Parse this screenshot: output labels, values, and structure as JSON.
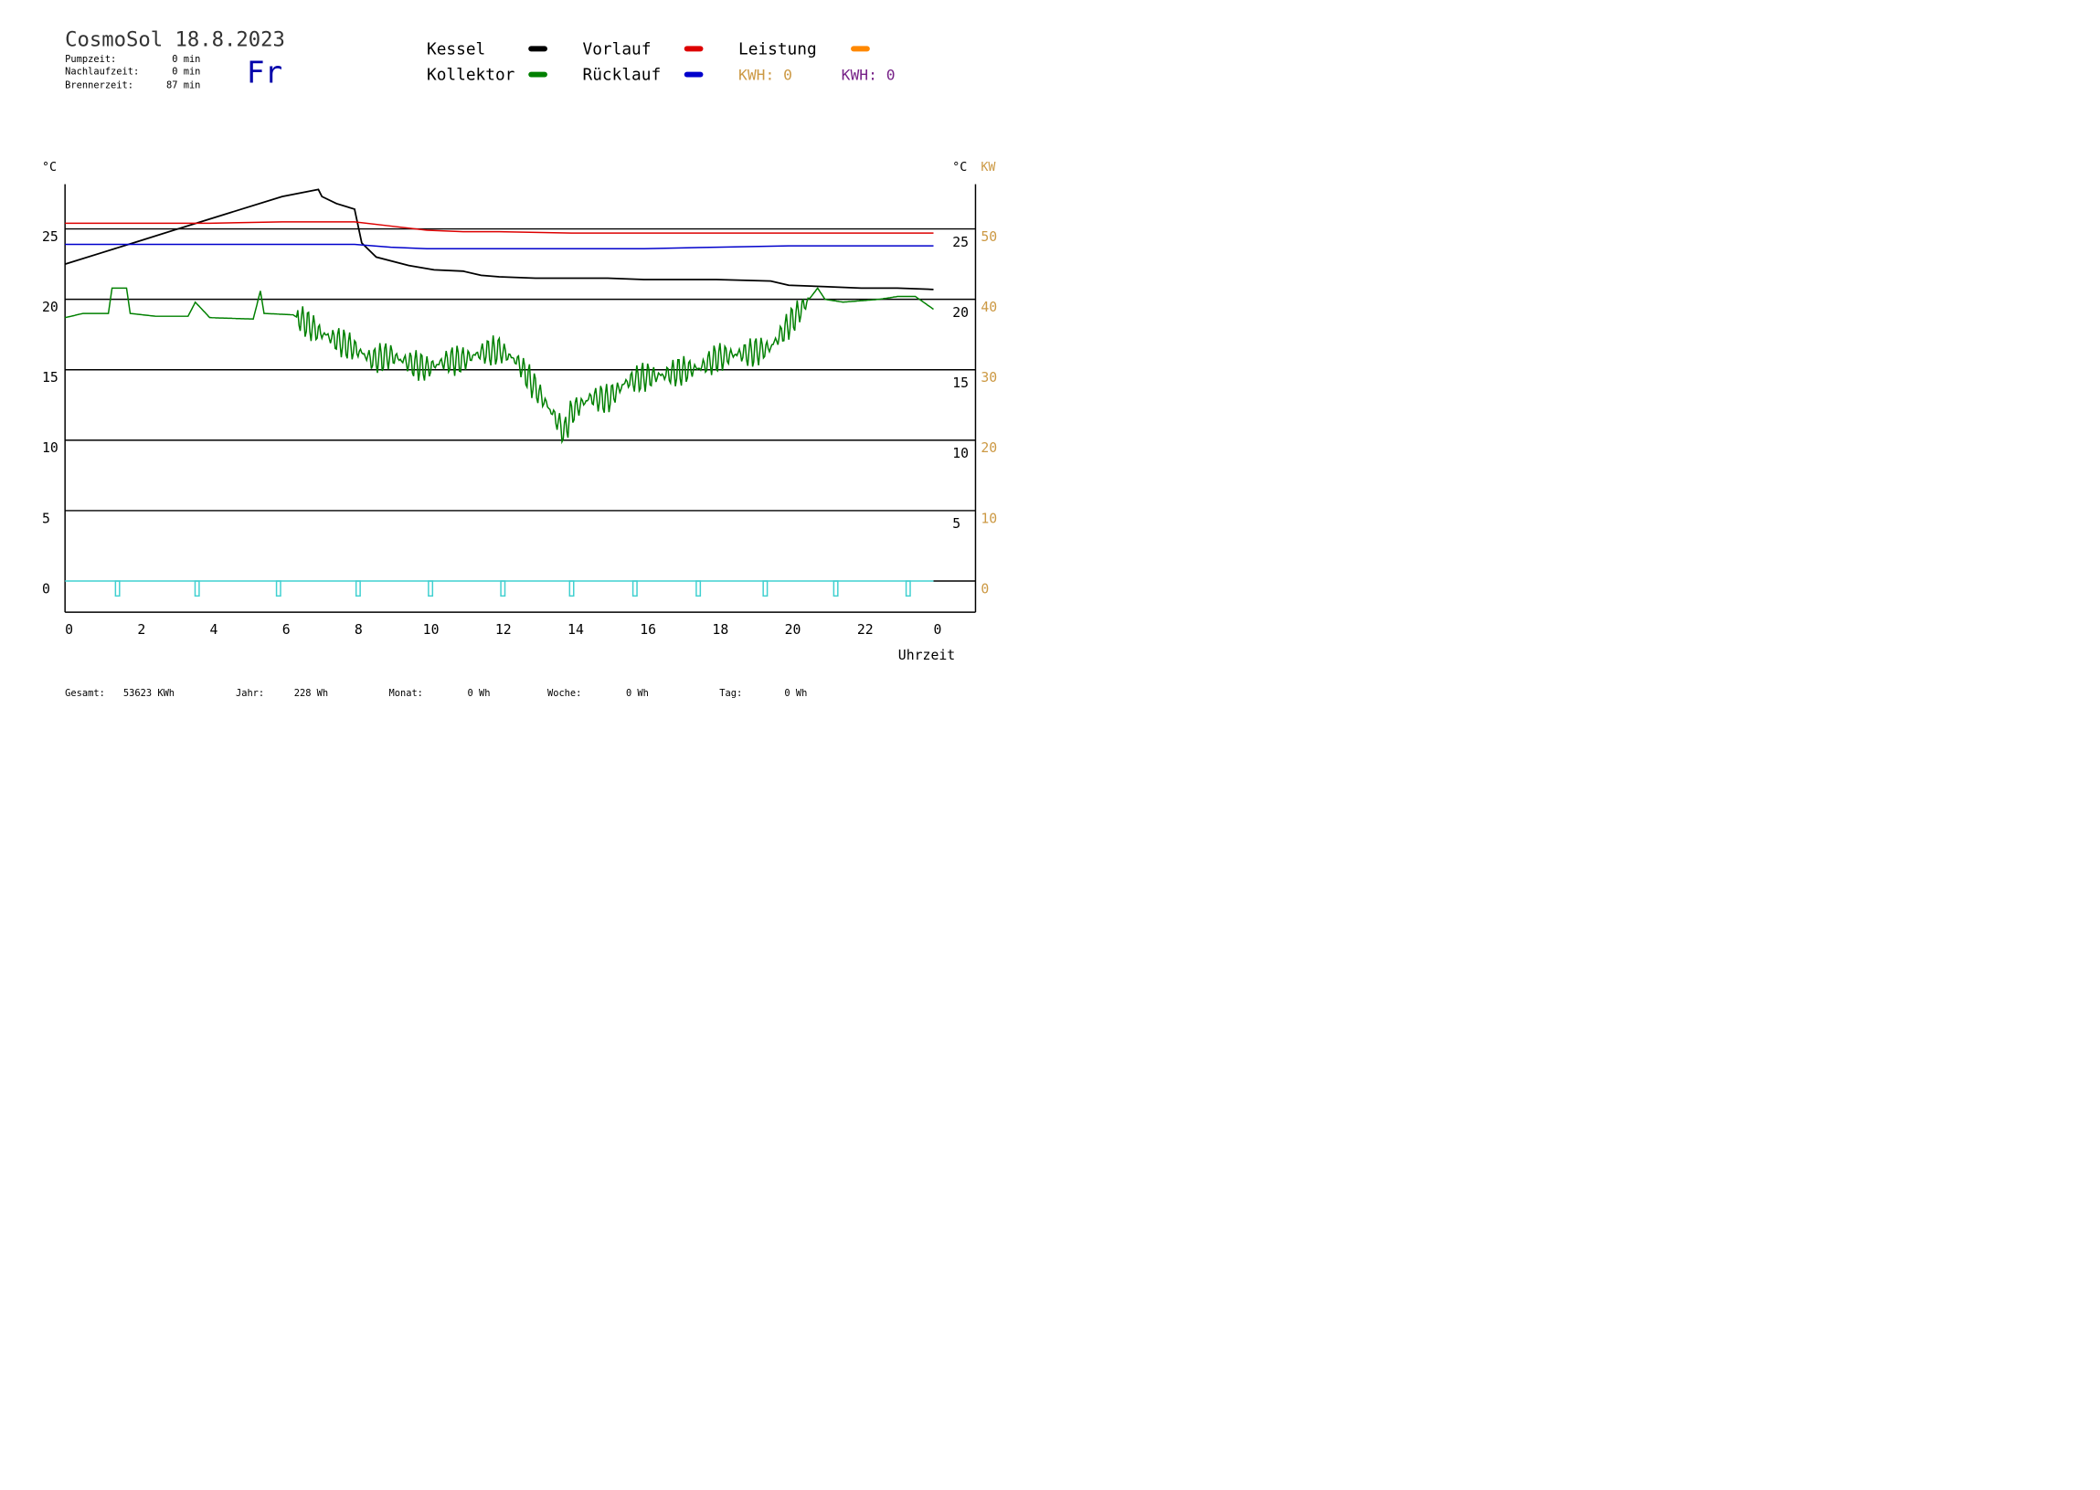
{
  "header": {
    "title": "CosmoSol 18.8.2023",
    "weekday": "Fr",
    "stats": [
      {
        "label": "Pumpzeit:",
        "value": "0 min"
      },
      {
        "label": "Nachlaufzeit:",
        "value": "0 min"
      },
      {
        "label": "Brennerzeit:",
        "value": "87 min"
      }
    ]
  },
  "legend": {
    "items": [
      {
        "label": "Kessel",
        "color": "#000000"
      },
      {
        "label": "Vorlauf",
        "color": "#dd0000"
      },
      {
        "label": "Leistung",
        "color": "#ff8800"
      },
      {
        "label": "Kollektor",
        "color": "#008000"
      },
      {
        "label": "Rücklauf",
        "color": "#0000cc"
      }
    ],
    "kwh1": "KWH: 0",
    "kwh1_color": "#cc9944",
    "kwh2": "KWH: 0",
    "kwh2_color": "#772288"
  },
  "footer": [
    {
      "label": "Gesamt:",
      "value": "53623 KWh"
    },
    {
      "label": "Jahr:",
      "value": "228 Wh"
    },
    {
      "label": "Monat:",
      "value": "0 Wh"
    },
    {
      "label": "Woche:",
      "value": "0 Wh"
    },
    {
      "label": "Tag:",
      "value": "0 Wh"
    }
  ],
  "chart_data": {
    "type": "line",
    "xlabel": "Uhrzeit",
    "xlim": [
      0,
      24
    ],
    "x_ticks": [
      "0",
      "2",
      "4",
      "6",
      "8",
      "10",
      "12",
      "14",
      "16",
      "18",
      "20",
      "22",
      "0"
    ],
    "y_left_unit": "°C",
    "y_right_unit": "°C",
    "y_right2_unit": "KW",
    "ylim": [
      -2,
      30
    ],
    "y_ticks_left": [
      "0",
      "5",
      "10",
      "15",
      "20",
      "25"
    ],
    "y_ticks_right": [
      "5",
      "10",
      "15",
      "20",
      "25"
    ],
    "y_ticks_kw": [
      "0",
      "10",
      "20",
      "30",
      "40",
      "50"
    ],
    "grid": true,
    "colors": {
      "kessel": "#000000",
      "vorlauf": "#dd0000",
      "ruecklauf": "#0000cc",
      "kollektor": "#008000",
      "pumpe": "#40d0d0"
    },
    "series": [
      {
        "name": "Kessel",
        "key": "kessel",
        "x": [
          0,
          1,
          2,
          3,
          4,
          5,
          6,
          7,
          7.1,
          7.5,
          8,
          8.2,
          8.6,
          9.5,
          10.2,
          11,
          11.5,
          12,
          13,
          15,
          16,
          17,
          18,
          19.5,
          20,
          21,
          22,
          23,
          24
        ],
        "y": [
          22.5,
          23.3,
          24.1,
          24.9,
          25.7,
          26.5,
          27.3,
          27.8,
          27.3,
          26.8,
          26.4,
          24.0,
          23.0,
          22.4,
          22.1,
          22.0,
          21.7,
          21.6,
          21.5,
          21.5,
          21.4,
          21.4,
          21.4,
          21.3,
          21.0,
          20.9,
          20.8,
          20.8,
          20.7
        ]
      },
      {
        "name": "Vorlauf",
        "key": "vorlauf",
        "x": [
          0,
          2,
          4,
          6,
          8,
          9,
          10,
          11,
          12,
          14,
          16,
          18,
          20,
          22,
          24
        ],
        "y": [
          25.4,
          25.4,
          25.4,
          25.5,
          25.5,
          25.2,
          24.9,
          24.8,
          24.8,
          24.7,
          24.7,
          24.7,
          24.7,
          24.7,
          24.7
        ]
      },
      {
        "name": "Rücklauf",
        "key": "ruecklauf",
        "x": [
          0,
          2,
          4,
          6,
          8,
          9,
          10,
          12,
          14,
          16,
          18,
          20,
          22,
          24
        ],
        "y": [
          23.9,
          23.9,
          23.9,
          23.9,
          23.9,
          23.7,
          23.6,
          23.6,
          23.6,
          23.6,
          23.7,
          23.8,
          23.8,
          23.8
        ]
      },
      {
        "name": "Kollektor",
        "key": "kollektor",
        "x": [
          0,
          0.5,
          1.2,
          1.3,
          1.7,
          1.8,
          2.5,
          3.4,
          3.6,
          4,
          5.2,
          5.4,
          5.5,
          6.3,
          6.5,
          7,
          7.5,
          8,
          8.5,
          9,
          9.5,
          10,
          10.5,
          11,
          11.5,
          12,
          12.5,
          13,
          13.5,
          13.8,
          14,
          14.5,
          15,
          15.5,
          16,
          16.5,
          17,
          17.5,
          18,
          18.5,
          19,
          19.5,
          20,
          20.5,
          20.8,
          21,
          21.5,
          22,
          22.5,
          23,
          23.5,
          24
        ],
        "y": [
          18.7,
          19.0,
          19.0,
          20.8,
          20.8,
          19.0,
          18.8,
          18.8,
          19.8,
          18.7,
          18.6,
          20.6,
          19.0,
          18.9,
          18.6,
          17.7,
          17.1,
          16.5,
          15.7,
          16.0,
          15.5,
          15.1,
          15.6,
          15.7,
          16.2,
          16.4,
          15.6,
          13.7,
          11.8,
          10.5,
          12.0,
          13.0,
          12.9,
          14.1,
          14.5,
          14.6,
          14.9,
          15.1,
          15.8,
          16.1,
          16.2,
          16.6,
          18.2,
          19.8,
          20.8,
          20.0,
          19.8,
          19.9,
          20.0,
          20.2,
          20.2,
          19.3
        ]
      },
      {
        "name": "Pumpe",
        "key": "pumpe",
        "x": [
          1.45,
          3.65,
          5.9,
          8.1,
          10.1,
          12.1,
          14.0,
          15.75,
          17.5,
          19.35,
          21.3,
          23.3
        ],
        "y": [
          0,
          0,
          0,
          0,
          0,
          0,
          0,
          0,
          0,
          0,
          0,
          0
        ]
      }
    ]
  }
}
